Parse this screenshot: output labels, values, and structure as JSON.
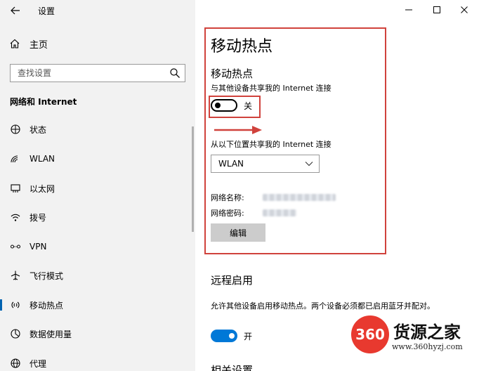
{
  "window": {
    "title": "设置",
    "minimize_glyph": "—",
    "maximize_glyph": "☐",
    "close_glyph": "✕"
  },
  "sidebar": {
    "home_label": "主页",
    "search_placeholder": "查找设置",
    "section_title": "网络和 Internet",
    "items": [
      {
        "label": "状态",
        "icon": "status-icon"
      },
      {
        "label": "WLAN",
        "icon": "wifi-icon"
      },
      {
        "label": "以太网",
        "icon": "ethernet-icon"
      },
      {
        "label": "拨号",
        "icon": "dialup-icon"
      },
      {
        "label": "VPN",
        "icon": "vpn-icon"
      },
      {
        "label": "飞行模式",
        "icon": "airplane-icon"
      },
      {
        "label": "移动热点",
        "icon": "hotspot-icon",
        "active": true
      },
      {
        "label": "数据使用量",
        "icon": "data-usage-icon"
      },
      {
        "label": "代理",
        "icon": "globe-icon"
      }
    ]
  },
  "main": {
    "page_title": "移动热点",
    "hotspot": {
      "subtitle": "移动热点",
      "share_desc": "与其他设备共享我的 Internet 连接",
      "toggle_state": "关",
      "share_from_label": "从以下位置共享我的 Internet 连接",
      "share_from_value": "WLAN",
      "network_name_label": "网络名称:",
      "network_password_label": "网络密码:",
      "edit_button": "编辑"
    },
    "remote": {
      "title": "远程启用",
      "desc": "允许其他设备启用移动热点。两个设备必须都已启用蓝牙并配对。",
      "toggle_state": "开"
    },
    "related_title": "相关设置"
  },
  "watermark": {
    "badge": "360",
    "brand": "货源之家",
    "url": "www.360hyzj.com"
  },
  "colors": {
    "accent": "#0078d7",
    "highlight_red": "#d0423c"
  }
}
